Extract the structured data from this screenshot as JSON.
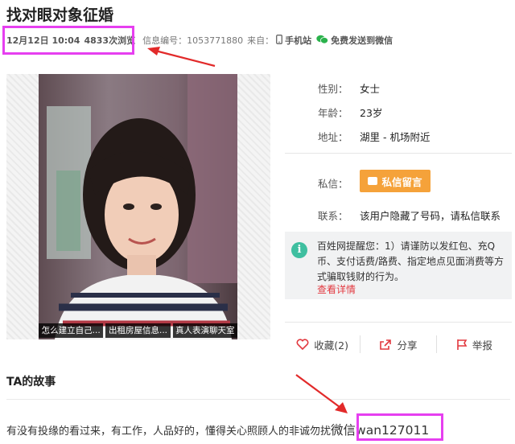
{
  "listing": {
    "title": "找对眼对象征婚",
    "date": "12月12日 10:04",
    "views": "4833次浏览",
    "id_label": "信息编号：",
    "id_value": "1053771880",
    "source_label": "来自：",
    "source_value": "手机站",
    "send_wechat": "免费发送到微信"
  },
  "photos": {
    "thumbs": [
      "怎么建立自己...",
      "出租房屋信息...",
      "真人表演聊天室"
    ]
  },
  "profile": {
    "gender_label": "性别：",
    "gender_value": "女士",
    "age_label": "年龄：",
    "age_value": "23岁",
    "address_label": "地址：",
    "address_value": "湖里 - 机场附近",
    "message_label": "私信：",
    "message_button": "私信留言",
    "contact_label": "联系：",
    "contact_value": "该用户隐藏了号码，请私信联系"
  },
  "notice": {
    "text": "百姓网提醒您：1）请谨防以发红包、充Q币、支付话费/路费、指定地点见面消费等方式骗取钱财的行为。",
    "link": "查看详情"
  },
  "actions": {
    "favorite": "收藏(2)",
    "share": "分享",
    "report": "举报"
  },
  "story": {
    "title": "TA的故事",
    "text": "有没有投缘的看过来，有工作，人品好的，懂得关心照顾人的非诚勿扰",
    "wechat": "微信wan127011"
  },
  "colors": {
    "highlight": "#e63ff0",
    "arrow": "#e22a2a",
    "button": "#f5a23a",
    "link": "#e2383f"
  }
}
